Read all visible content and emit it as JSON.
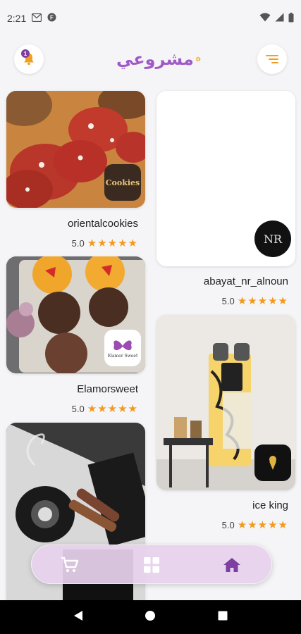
{
  "status": {
    "time": "2:21"
  },
  "header": {
    "logo_text": "مشروعي",
    "notification_count": "1"
  },
  "colors": {
    "accent": "#7d3fa0",
    "star": "#f29a1f",
    "logo": "#a05ac8"
  },
  "stores": [
    {
      "name": "orientalcookies",
      "rating": "5.0",
      "stars": "★★★★★",
      "logo_text": "Cookies"
    },
    {
      "name": "abayat_nr_alnoun",
      "rating": "5.0",
      "stars": "★★★★★",
      "logo_text": "NR"
    },
    {
      "name": "Elamorsweet",
      "rating": "5.0",
      "stars": "★★★★★",
      "logo_text": "Elamor Sweet"
    },
    {
      "name": "ice king",
      "rating": "5.0",
      "stars": "★★★★★",
      "logo_text": ""
    },
    {
      "name": "",
      "rating": "",
      "stars": "",
      "logo_text": ""
    }
  ],
  "nav": {
    "items": [
      "cart-icon",
      "grid-icon",
      "home-icon"
    ],
    "active": "home-icon"
  }
}
